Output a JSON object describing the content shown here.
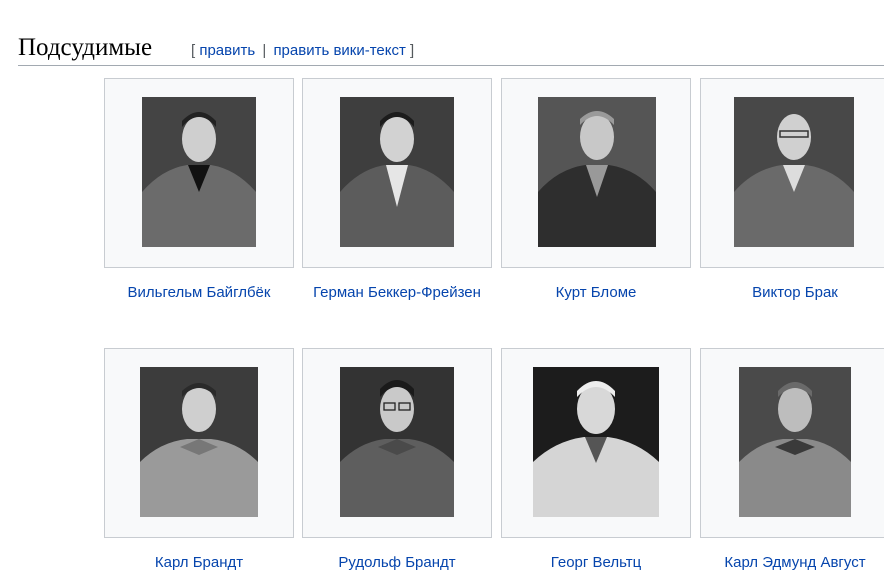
{
  "section": {
    "title": "Подсудимые",
    "bracket_open": "[",
    "edit_label": "править",
    "separator": "|",
    "edit_wiki_label": "править вики-текст",
    "bracket_close": "]"
  },
  "gallery": {
    "items": [
      {
        "caption": "Вильгельм Байглбёк",
        "photo_icon": "portrait-photo"
      },
      {
        "caption": "Герман Беккер-Фрейзен",
        "photo_icon": "portrait-photo"
      },
      {
        "caption": "Курт Бломе",
        "photo_icon": "portrait-photo"
      },
      {
        "caption": "Виктор Брак",
        "photo_icon": "portrait-photo"
      },
      {
        "caption": "Карл Брандт",
        "photo_icon": "portrait-photo"
      },
      {
        "caption": "Рудольф Брандт",
        "photo_icon": "portrait-photo"
      },
      {
        "caption": "Георг Вельтц",
        "photo_icon": "portrait-photo"
      },
      {
        "caption": "Карл Эдмунд Август",
        "photo_icon": "portrait-photo"
      }
    ]
  },
  "colors": {
    "link": "#0645ad",
    "thumb_bg": "#f8f9fa",
    "thumb_border": "#c8ccd1",
    "heading_rule": "#a2a9b1"
  }
}
